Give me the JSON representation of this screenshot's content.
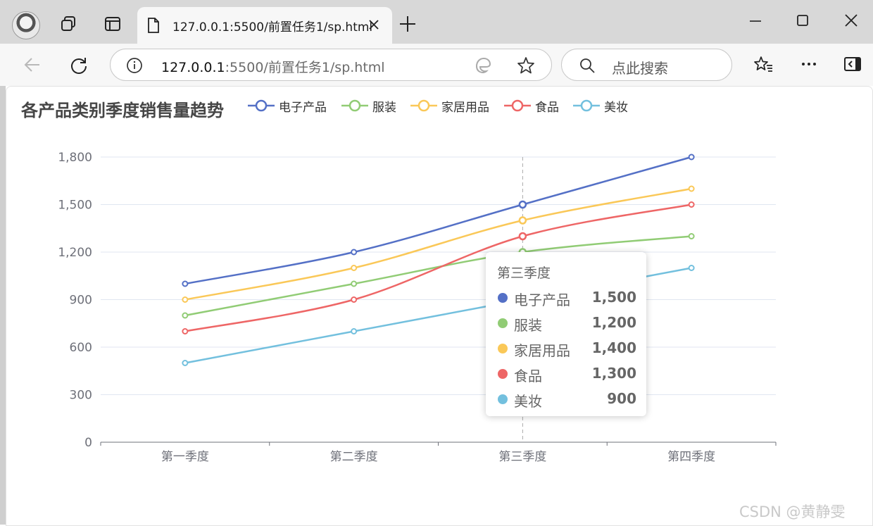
{
  "browser": {
    "tab_title": "127.0.0.1:5500/前置任务1/sp.html",
    "url_host": "127.0.0.1",
    "url_rest": ":5500/前置任务1/sp.html",
    "search_placeholder": "点此搜索"
  },
  "chart_data": {
    "type": "line",
    "title": "各产品类别季度销售量趋势",
    "categories": [
      "第一季度",
      "第二季度",
      "第三季度",
      "第四季度"
    ],
    "ylim": [
      0,
      1800
    ],
    "yticks": [
      0,
      300,
      600,
      900,
      1200,
      1500,
      1800
    ],
    "ytick_labels": [
      "0",
      "300",
      "600",
      "900",
      "1,200",
      "1,500",
      "1,800"
    ],
    "grid": true,
    "legend_position": "top",
    "smooth": true,
    "series": [
      {
        "name": "电子产品",
        "color": "#5470c6",
        "values": [
          1000,
          1200,
          1500,
          1800
        ]
      },
      {
        "name": "服装",
        "color": "#91cc75",
        "values": [
          800,
          1000,
          1200,
          1300
        ]
      },
      {
        "name": "家居用品",
        "color": "#fac858",
        "values": [
          900,
          1100,
          1400,
          1600
        ]
      },
      {
        "name": "食品",
        "color": "#ee6666",
        "values": [
          700,
          900,
          1300,
          1500
        ]
      },
      {
        "name": "美妆",
        "color": "#73c0de",
        "values": [
          500,
          700,
          900,
          1100
        ]
      }
    ],
    "tooltip": {
      "title": "第三季度",
      "rows": [
        {
          "name": "电子产品",
          "value": "1,500",
          "color": "#5470c6"
        },
        {
          "name": "服装",
          "value": "1,200",
          "color": "#91cc75"
        },
        {
          "name": "家居用品",
          "value": "1,400",
          "color": "#fac858"
        },
        {
          "name": "食品",
          "value": "1,300",
          "color": "#ee6666"
        },
        {
          "name": "美妆",
          "value": "900",
          "color": "#73c0de"
        }
      ]
    }
  },
  "watermark": "CSDN @黄静雯"
}
